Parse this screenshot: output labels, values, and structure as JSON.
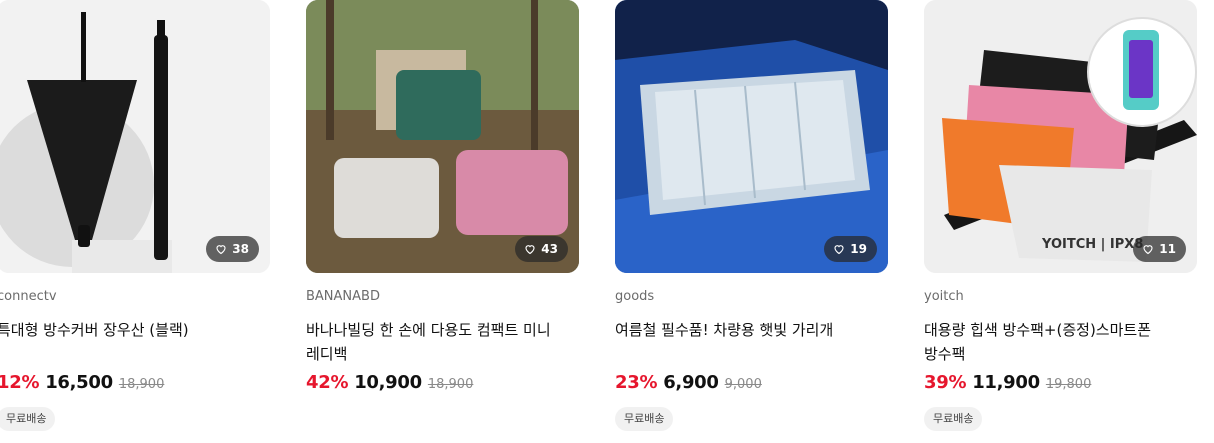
{
  "products": [
    {
      "brand": "connectv",
      "title": "특대형 방수커버 장우산 (블랙)",
      "discount": "12%",
      "price": "16,500",
      "original_price": "18,900",
      "likes": "38",
      "shipping": "무료배송",
      "image_subject": "black-umbrella-image"
    },
    {
      "brand": "BANANABD",
      "title": "바나나빌딩 한 손에 다용도 컴팩트 미니 레디백",
      "discount": "42%",
      "price": "10,900",
      "original_price": "18,900",
      "likes": "43",
      "image_subject": "mini-suitcases-image"
    },
    {
      "brand": "goods",
      "title": "여름철 필수품! 차량용 햇빛 가리개",
      "discount": "23%",
      "price": "6,900",
      "original_price": "9,000",
      "likes": "19",
      "shipping": "무료배송",
      "image_subject": "car-sunshade-image"
    },
    {
      "brand": "yoitch",
      "title": "대용량 힙색 방수팩+(증정)스마트폰 방수팩",
      "discount": "39%",
      "price": "11,900",
      "original_price": "19,800",
      "likes": "11",
      "shipping": "무료배송",
      "image_subject": "waterproof-bags-image",
      "image_logo_text": "YOITCH | IPX8"
    }
  ],
  "colors": {
    "discount": "#e6162d",
    "like_badge_bg": "#282828",
    "shipping_bg": "#f1f1f1"
  }
}
